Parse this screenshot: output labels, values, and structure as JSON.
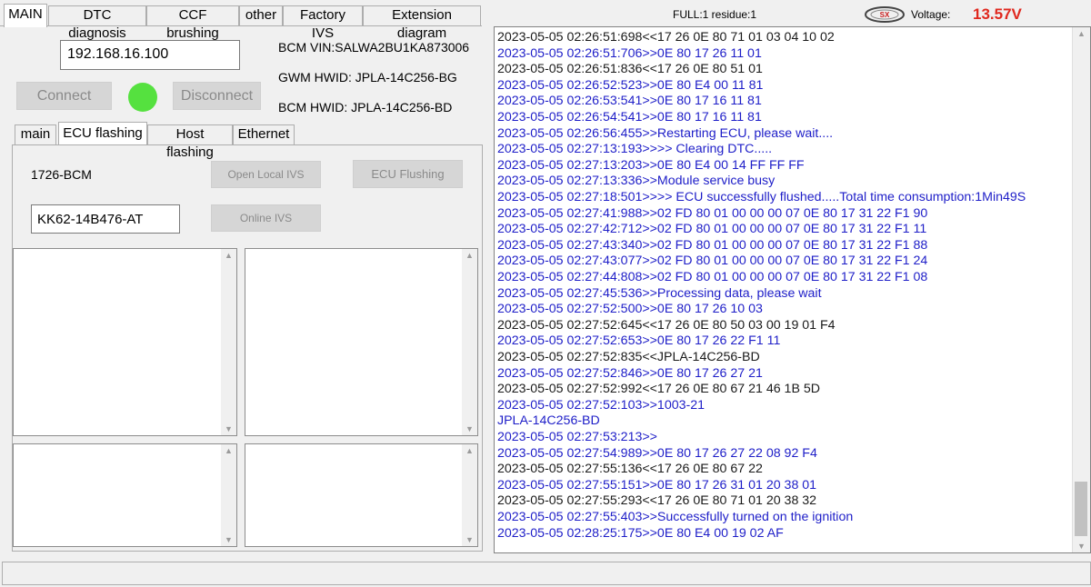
{
  "top_tabs": [
    "MAIN",
    "DTC diagnosis",
    "CCF brushing",
    "other",
    "Factory IVS",
    "Extension diagram"
  ],
  "status": {
    "full_residue": "FULL:1 residue:1",
    "logo": "sx-logo-icon",
    "voltage_label": "Voltage:",
    "voltage_value": "13.57V"
  },
  "connection": {
    "ip_address": "192.168.16.100",
    "connect_label": "Connect",
    "disconnect_label": "Disconnect",
    "bcm_vin": "BCM VIN:SALWA2BU1KA873006",
    "gwm_hwid": "GWM HWID:  JPLA-14C256-BG",
    "bcm_hwid": "BCM HWID:  JPLA-14C256-BD",
    "status_color": "#55e13f"
  },
  "sub_tabs": [
    "main",
    "ECU flashing",
    "Host flashing",
    "Ethernet"
  ],
  "ecu_flashing": {
    "module_name": "1726-BCM",
    "part_number": "KK62-14B476-AT",
    "open_local_ivs_label": "Open Local IVS",
    "ecu_flashing_label": "ECU Flushing",
    "online_ivs_label": "Online IVS"
  },
  "log_lines": [
    {
      "text": "2023-05-05 02:26:51:698<<17 26 0E 80 71 01 03 04 10 02",
      "color": "black"
    },
    {
      "text": "2023-05-05 02:26:51:706>>0E 80 17 26 11 01",
      "color": "blue"
    },
    {
      "text": "2023-05-05 02:26:51:836<<17 26 0E 80 51 01",
      "color": "black"
    },
    {
      "text": "2023-05-05 02:26:52:523>>0E 80 E4 00 11 81",
      "color": "blue"
    },
    {
      "text": "2023-05-05 02:26:53:541>>0E 80 17 16 11 81",
      "color": "blue"
    },
    {
      "text": "2023-05-05 02:26:54:541>>0E 80 17 16 11 81",
      "color": "blue"
    },
    {
      "text": "2023-05-05 02:26:56:455>>Restarting ECU, please wait....",
      "color": "blue"
    },
    {
      "text": "2023-05-05 02:27:13:193>>>> Clearing DTC.....",
      "color": "blue"
    },
    {
      "text": "2023-05-05 02:27:13:203>>0E 80 E4 00 14 FF FF FF",
      "color": "blue"
    },
    {
      "text": "2023-05-05 02:27:13:336>>Module service busy",
      "color": "blue"
    },
    {
      "text": "2023-05-05 02:27:18:501>>>> ECU successfully flushed.....Total time consumption:1Min49S",
      "color": "blue"
    },
    {
      "text": "2023-05-05 02:27:41:988>>02 FD 80 01 00 00 00 07 0E 80 17 31 22 F1 90",
      "color": "blue"
    },
    {
      "text": "2023-05-05 02:27:42:712>>02 FD 80 01 00 00 00 07 0E 80 17 31 22 F1 11",
      "color": "blue"
    },
    {
      "text": "2023-05-05 02:27:43:340>>02 FD 80 01 00 00 00 07 0E 80 17 31 22 F1 88",
      "color": "blue"
    },
    {
      "text": "2023-05-05 02:27:43:077>>02 FD 80 01 00 00 00 07 0E 80 17 31 22 F1 24",
      "color": "blue"
    },
    {
      "text": "2023-05-05 02:27:44:808>>02 FD 80 01 00 00 00 07 0E 80 17 31 22 F1 08",
      "color": "blue"
    },
    {
      "text": "2023-05-05 02:27:45:536>>Processing data, please wait",
      "color": "blue"
    },
    {
      "text": "2023-05-05 02:27:52:500>>0E 80 17 26 10 03",
      "color": "blue"
    },
    {
      "text": "2023-05-05 02:27:52:645<<17 26 0E 80 50 03 00 19 01 F4",
      "color": "black"
    },
    {
      "text": "2023-05-05 02:27:52:653>>0E 80 17 26 22 F1 11",
      "color": "blue"
    },
    {
      "text": "2023-05-05 02:27:52:835<<JPLA-14C256-BD",
      "color": "black"
    },
    {
      "text": "2023-05-05 02:27:52:846>>0E 80 17 26 27 21",
      "color": "blue"
    },
    {
      "text": "2023-05-05 02:27:52:992<<17 26 0E 80 67 21 46 1B 5D",
      "color": "black"
    },
    {
      "text": "2023-05-05 02:27:52:103>>1003-21",
      "color": "blue"
    },
    {
      "text": "JPLA-14C256-BD",
      "color": "blue"
    },
    {
      "text": "2023-05-05 02:27:53:213>>",
      "color": "blue"
    },
    {
      "text": "2023-05-05 02:27:54:989>>0E 80 17 26 27 22 08 92 F4",
      "color": "blue"
    },
    {
      "text": "2023-05-05 02:27:55:136<<17 26 0E 80 67 22",
      "color": "black"
    },
    {
      "text": "2023-05-05 02:27:55:151>>0E 80 17 26 31 01 20 38 01",
      "color": "blue"
    },
    {
      "text": "2023-05-05 02:27:55:293<<17 26 0E 80 71 01 20 38 32",
      "color": "black"
    },
    {
      "text": "2023-05-05 02:27:55:403>>Successfully turned on the ignition",
      "color": "blue"
    },
    {
      "text": "2023-05-05 02:28:25:175>>0E 80 E4 00 19 02 AF",
      "color": "blue"
    }
  ]
}
